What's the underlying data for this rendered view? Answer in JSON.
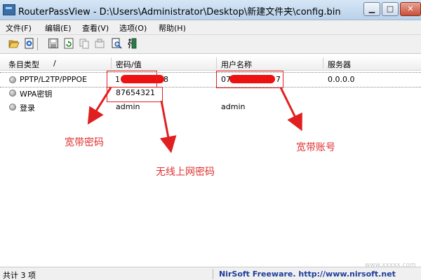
{
  "window": {
    "title": "RouterPassView  -  D:\\Users\\Administrator\\Desktop\\新建文件夹\\config.bin"
  },
  "menu": [
    "文件(F)",
    "编辑(E)",
    "查看(V)",
    "选项(O)",
    "帮助(H)"
  ],
  "toolbar_icons": [
    "open-folder-icon",
    "open-file-icon",
    "save-icon",
    "refresh-icon",
    "copy-icon",
    "properties-icon",
    "find-icon",
    "exit-icon"
  ],
  "table": {
    "columns": [
      "条目类型",
      "密码/值",
      "用户名称",
      "服务器"
    ],
    "sort_indicator": "/",
    "rows": [
      {
        "type": "PPTP/L2TP/PPPOE",
        "value_prefix": "1",
        "value_suffix": "8",
        "user_prefix": "07",
        "user_suffix": "7",
        "server": "0.0.0.0"
      },
      {
        "type": "WPA密钥",
        "value": "87654321",
        "user": "",
        "server": ""
      },
      {
        "type": "登录",
        "value": "admin",
        "user": "admin",
        "server": ""
      }
    ]
  },
  "annotations": {
    "broadband_password": "宽带密码",
    "wireless_password": "无线上网密码",
    "broadband_account": "宽带账号",
    "color": "#e02020"
  },
  "status": {
    "count": "共计 3 项",
    "vendor": "NirSoft Freeware.  http://www.nirsoft.net"
  },
  "watermark": "www.xxxxx.com"
}
